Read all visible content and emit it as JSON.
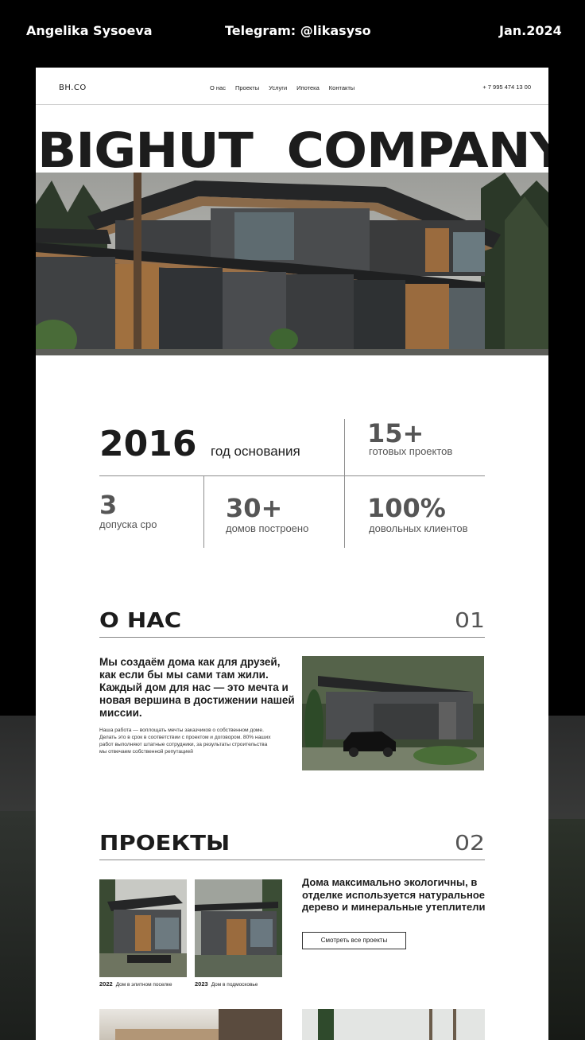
{
  "header": {
    "author": "Angelika Sysoeva",
    "telegram": "Telegram: @likasyso",
    "date": "Jan.2024"
  },
  "site": {
    "logo": "BH.CO",
    "menu": [
      "О нас",
      "Проекты",
      "Услуги",
      "Ипотека",
      "Контакты"
    ],
    "phone": "+ 7 995 474 13 00",
    "title": "BIGHUT  COMPANY"
  },
  "stats": [
    {
      "value": "2016",
      "label": "год основания"
    },
    {
      "value": "15+",
      "label": "готовых проектов"
    },
    {
      "value": "3",
      "label": "допуска сро"
    },
    {
      "value": "30+",
      "label": "домов построено"
    },
    {
      "value": "100%",
      "label": "довольных клиентов"
    }
  ],
  "about": {
    "title": "О НАС",
    "number": "01",
    "lead": "Мы создаём дома как для друзей, как если бы мы сами там жили. Каждый дом для нас — это мечта и новая вершина в достижении нашей миссии.",
    "small": "Наша работа — воплощать мечты заказчиков о собственном доме. Делать это в срок в соответствии с проектом и договором. 80% наших работ выполняют штатные сотрудники, за результаты строительства мы отвечаем собственной репутацией"
  },
  "projects": {
    "title": "ПРОЕКТЫ",
    "number": "02",
    "items": [
      {
        "year": "2022",
        "name": "Дом в элитном поселке"
      },
      {
        "year": "2023",
        "name": "Дом в подмосковье"
      }
    ],
    "text": "Дома максимально экологичны, в отделке используется натуральное дерево и минеральные утеплители",
    "button": "Смотреть  все проекты"
  }
}
